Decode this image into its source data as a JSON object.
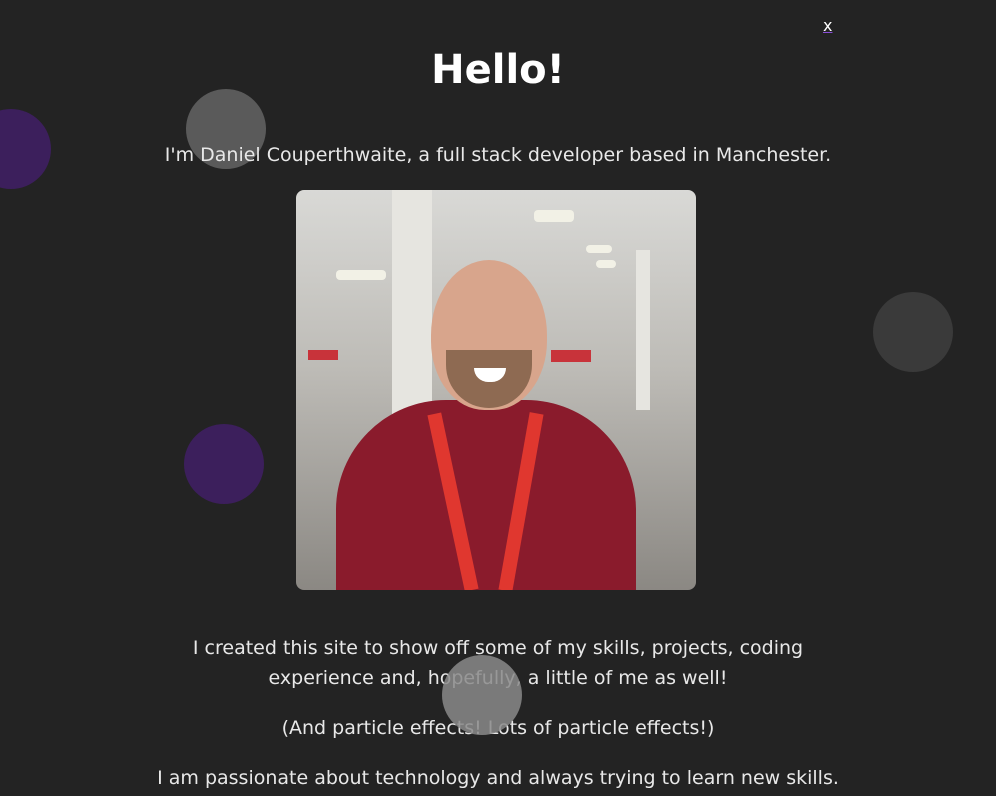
{
  "modal": {
    "close_label": "x",
    "title": "Hello!",
    "intro": "I'm Daniel Couperthwaite, a full stack developer based in Manchester.",
    "photo_alt": "Photo of Daniel Couperthwaite",
    "paragraphs": [
      "I created this site to show off some of my skills, projects, coding experience and, hopefully, a little of me as well!",
      "(And particle effects! Lots of particle effects!)",
      "I am passionate about technology and always trying to learn new skills."
    ]
  },
  "colors": {
    "background": "#232323",
    "accent": "#8a4fd8",
    "particle_purple": "#3c1f5c",
    "particle_gray": "#5a5a5a"
  }
}
